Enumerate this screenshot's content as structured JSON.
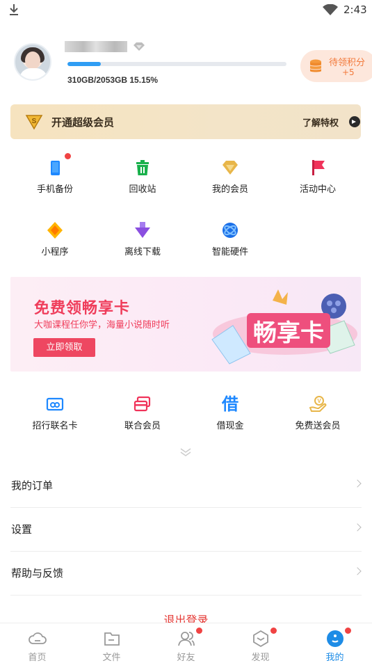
{
  "status": {
    "time": "2:43"
  },
  "profile": {
    "storage_text": "310GB/2053GB  15.15%",
    "storage_fraction": 0.1515,
    "points_label": "待领积分",
    "points_value": "+5"
  },
  "vip": {
    "title": "开通超级会员",
    "more": "了解特权"
  },
  "grid": [
    {
      "label": "手机备份",
      "icon": "phone-backup-icon",
      "color": "#1e88ff",
      "badge": true
    },
    {
      "label": "回收站",
      "icon": "trash-icon",
      "color": "#18b04b",
      "badge": false
    },
    {
      "label": "我的会员",
      "icon": "vip-diamond-icon",
      "color": "#e8b649",
      "badge": false
    },
    {
      "label": "活动中心",
      "icon": "flag-icon",
      "color": "#f0335a",
      "badge": false
    },
    {
      "label": "小程序",
      "icon": "mini-program-icon",
      "color": "#ffb400",
      "badge": false
    },
    {
      "label": "离线下载",
      "icon": "offline-download-icon",
      "color": "#8a4fe0",
      "badge": false
    },
    {
      "label": "智能硬件",
      "icon": "smart-hardware-icon",
      "color": "#1b6fe8",
      "badge": false
    }
  ],
  "banner": {
    "headline": "免费领畅享卡",
    "subtitle": "大咖课程任你学，海量小说随时听",
    "button": "立即领取",
    "art_text": "畅享卡"
  },
  "services": [
    {
      "label": "招行联名卡",
      "icon": "bank-card-icon",
      "color": "#1e88ff"
    },
    {
      "label": "联合会员",
      "icon": "joint-member-icon",
      "color": "#f0335a"
    },
    {
      "label": "借现金",
      "icon": "borrow-cash-icon",
      "color": "#1e88ff"
    },
    {
      "label": "免费送会员",
      "icon": "free-vip-icon",
      "color": "#e8b649"
    }
  ],
  "menu": [
    {
      "label": "我的订单"
    },
    {
      "label": "设置"
    },
    {
      "label": "帮助与反馈"
    }
  ],
  "logout": "退出登录",
  "tabs": [
    {
      "label": "首页",
      "icon": "home-cloud-icon",
      "badge": false,
      "active": false
    },
    {
      "label": "文件",
      "icon": "folder-icon",
      "badge": false,
      "active": false
    },
    {
      "label": "好友",
      "icon": "friends-icon",
      "badge": true,
      "active": false
    },
    {
      "label": "发现",
      "icon": "discover-icon",
      "badge": true,
      "active": false
    },
    {
      "label": "我的",
      "icon": "me-icon",
      "badge": true,
      "active": true
    }
  ],
  "colors": {
    "accent": "#1e8ce6",
    "danger": "#e53935",
    "banner_red": "#ef3d5b"
  }
}
